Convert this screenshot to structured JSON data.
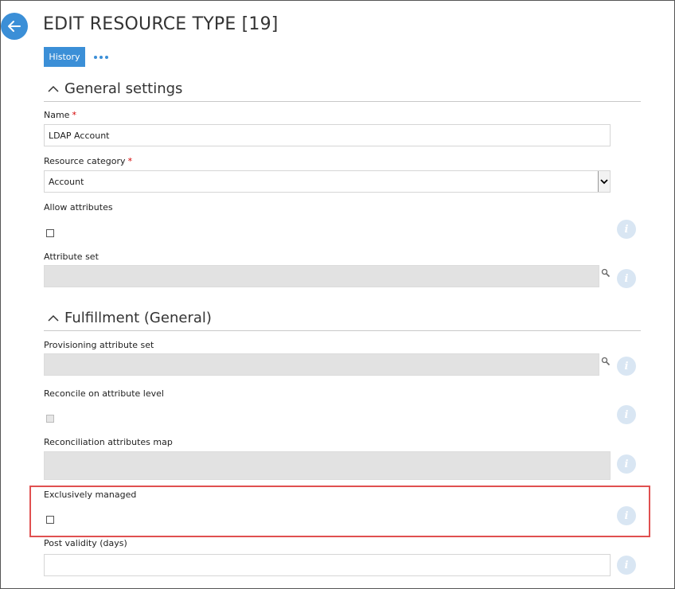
{
  "header": {
    "title": "EDIT RESOURCE TYPE [19]",
    "history_label": "History",
    "accent_color": "#3b8fd7"
  },
  "sections": {
    "general": {
      "title": "General settings"
    },
    "fulfillment": {
      "title": "Fulfillment (General)"
    }
  },
  "fields": {
    "name": {
      "label": "Name",
      "required_marker": "*",
      "value": "LDAP Account"
    },
    "resource_category": {
      "label": "Resource category",
      "required_marker": "*",
      "value": "Account"
    },
    "allow_attributes": {
      "label": "Allow attributes",
      "checked": false
    },
    "attribute_set": {
      "label": "Attribute set",
      "value": ""
    },
    "provisioning_attribute_set": {
      "label": "Provisioning attribute set",
      "value": ""
    },
    "reconcile_on_attribute_level": {
      "label": "Reconcile on attribute level",
      "checked": false
    },
    "reconciliation_attributes_map": {
      "label": "Reconciliation attributes map",
      "value": ""
    },
    "exclusively_managed": {
      "label": "Exclusively managed",
      "checked": false
    },
    "post_validity": {
      "label": "Post validity (days)",
      "value": ""
    }
  },
  "icons": {
    "back": "arrow-left-icon",
    "more": "more-dots-icon",
    "collapse": "chevron-up-icon",
    "info": "info-icon",
    "lookup": "magnifier-icon",
    "dropdown": "chevron-down-icon"
  },
  "highlight_color": "#e05050"
}
